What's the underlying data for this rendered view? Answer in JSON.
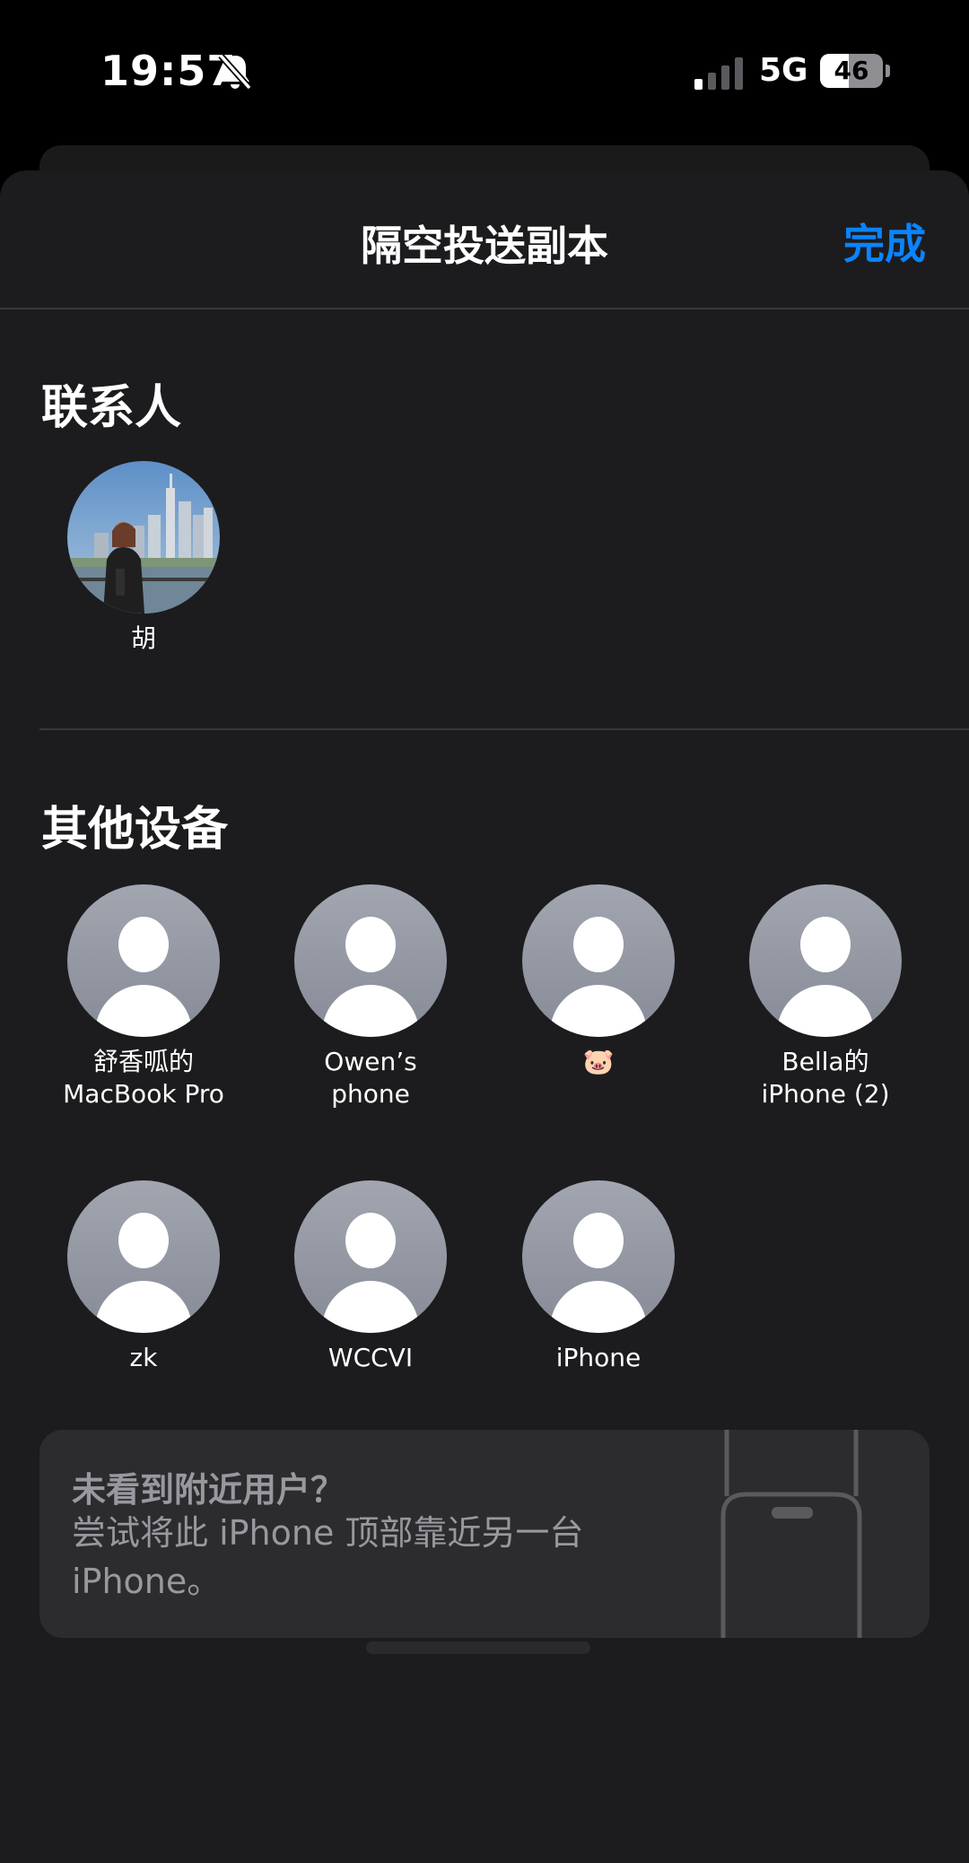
{
  "status_bar": {
    "time": "19:57",
    "network": "5G",
    "battery": "46",
    "battery_level": 0.46
  },
  "sheet": {
    "title": "隔空投送副本",
    "done_label": "完成"
  },
  "contacts_section": {
    "title": "联系人",
    "items": [
      {
        "label": "胡"
      }
    ]
  },
  "devices_section": {
    "title": "其他设备",
    "items": [
      {
        "label": "舒香呱的\nMacBook Pro"
      },
      {
        "label": "Owen’s\nphone"
      },
      {
        "label": "🐷"
      },
      {
        "label": "Bella的\niPhone (2)"
      },
      {
        "label": "zk"
      },
      {
        "label": "WCCVI"
      },
      {
        "label": "iPhone"
      }
    ]
  },
  "hint": {
    "title": "未看到附近用户？",
    "body": "尝试将此 iPhone 顶部靠近另一台 iPhone。"
  },
  "colors": {
    "accent": "#0a84ff",
    "sheet_bg": "#1c1c1e",
    "card_bg": "#2c2c2e"
  }
}
